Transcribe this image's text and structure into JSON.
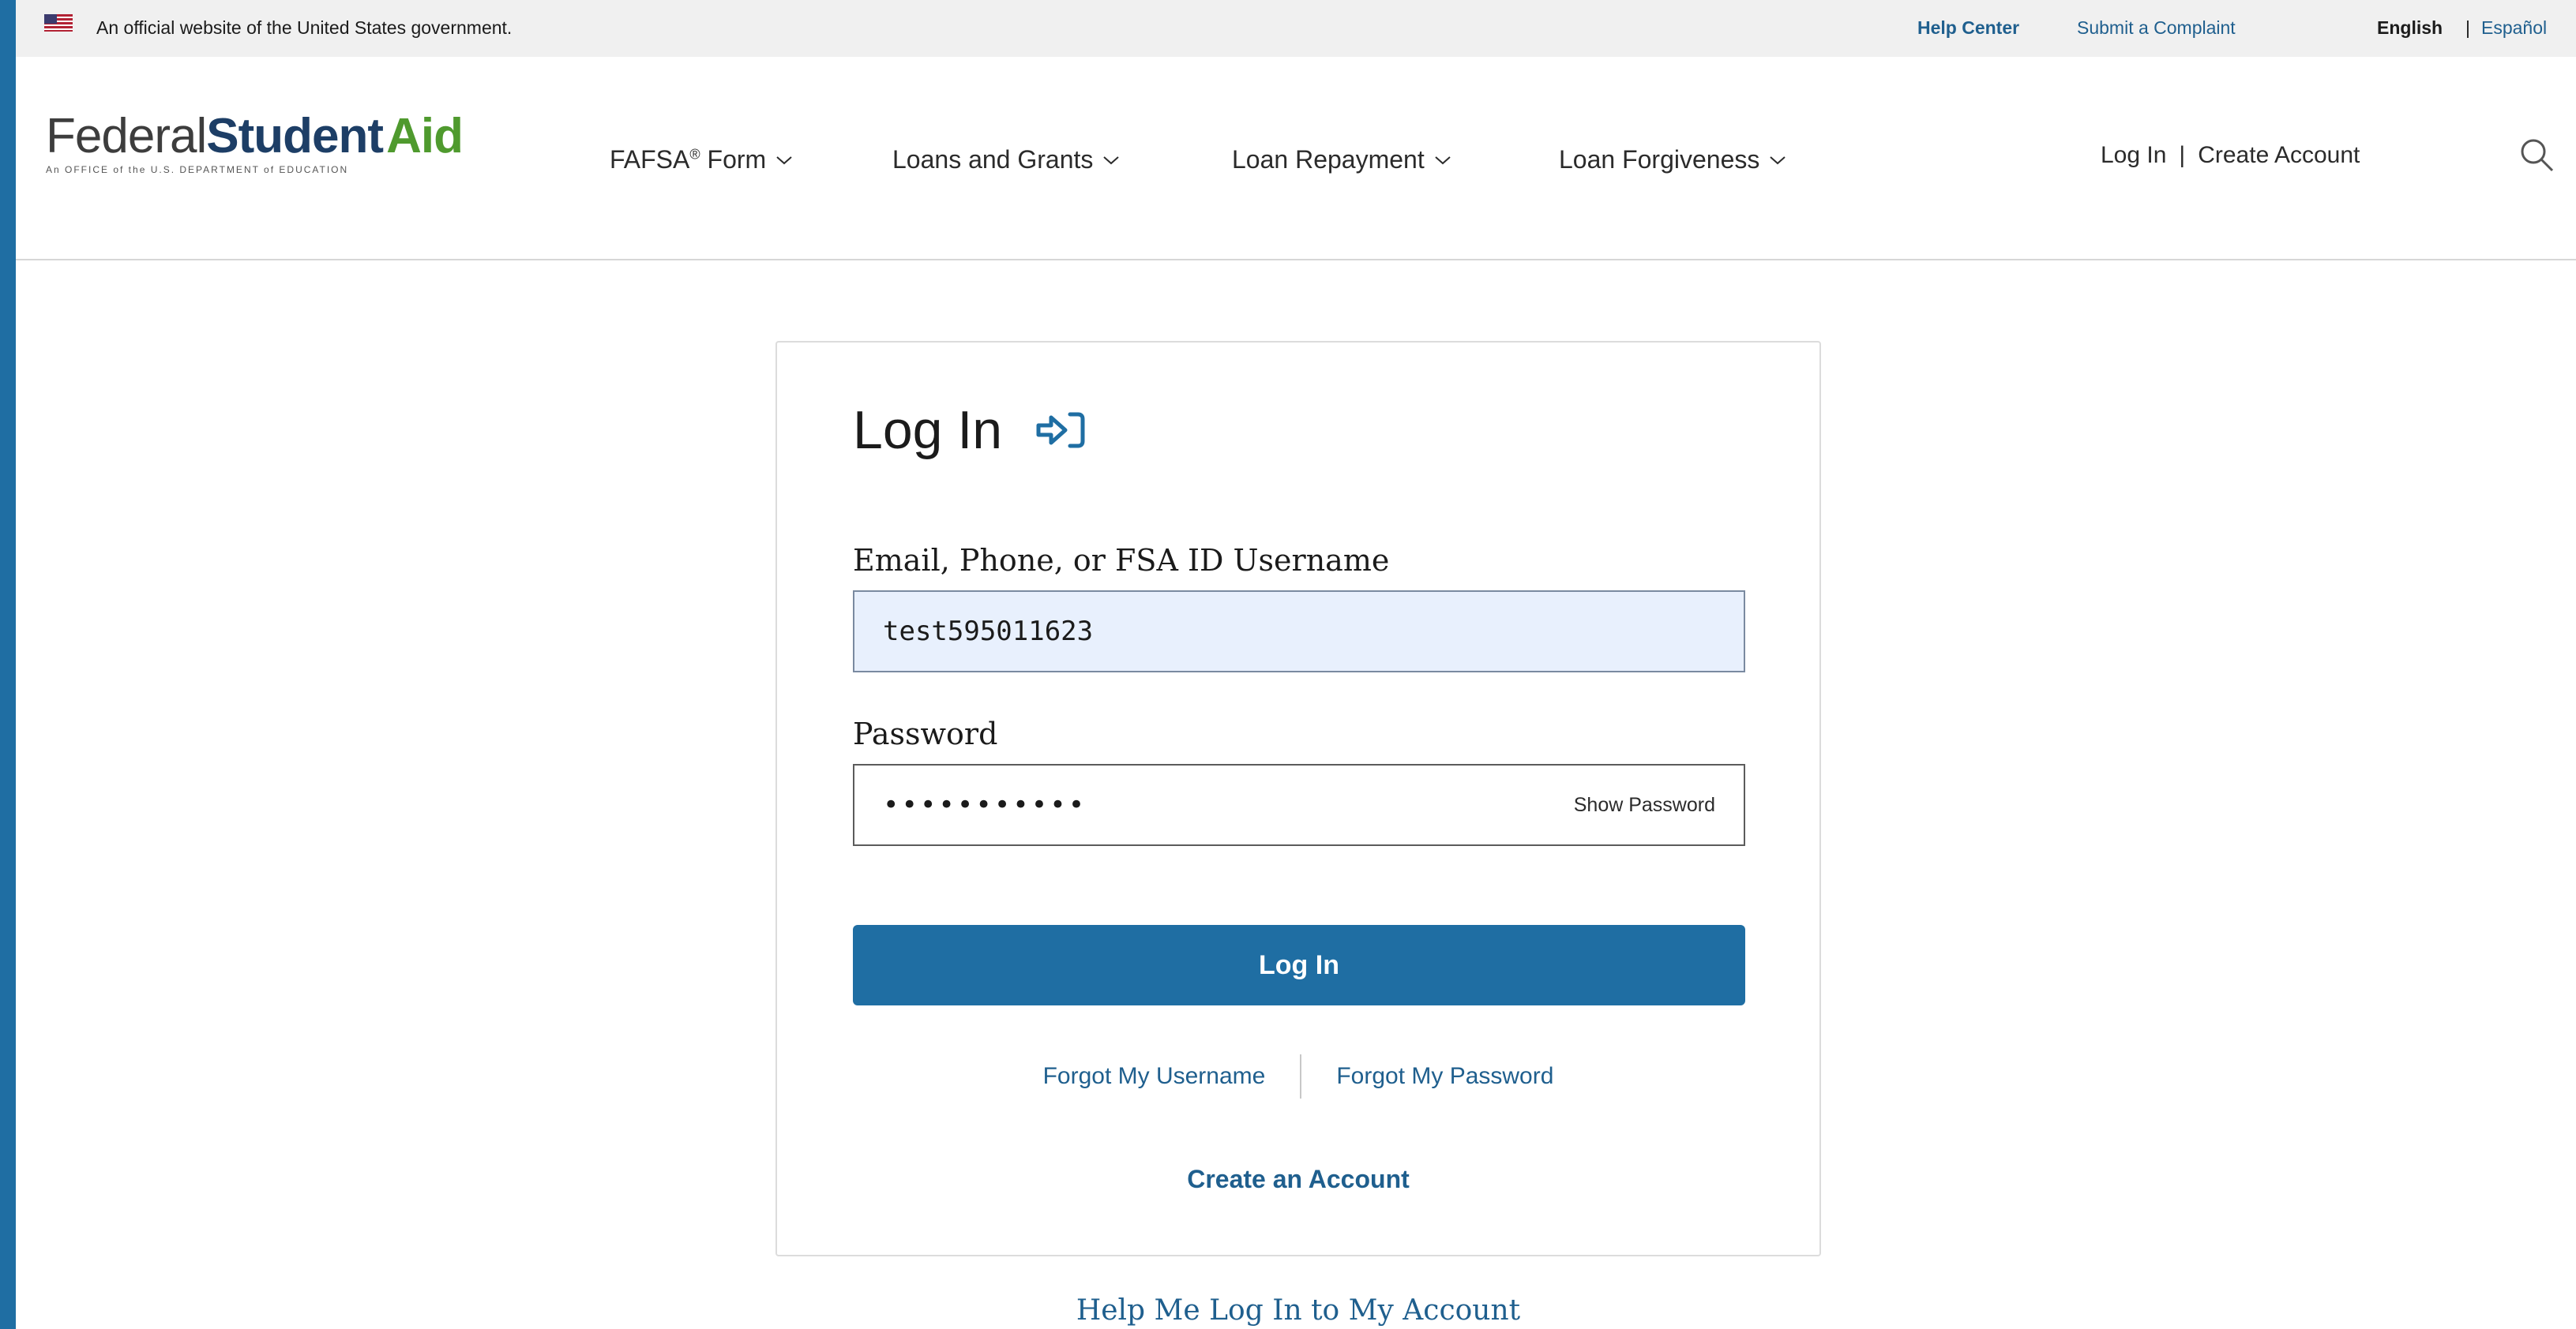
{
  "gov_banner": {
    "text": "An official website of the United States government.",
    "help_center": "Help Center",
    "complaint": "Submit a Complaint",
    "lang_english": "English",
    "lang_separator": "|",
    "lang_spanish": "Español"
  },
  "header": {
    "logo_federal": "Federal",
    "logo_student": "Student",
    "logo_aid": "Aid",
    "logo_subtitle": "An OFFICE of the U.S. DEPARTMENT of EDUCATION",
    "nav": {
      "fafsa": "FAFSA",
      "fafsa_mark": "®",
      "fafsa_suffix": "Form",
      "loans": "Loans and Grants",
      "repayment": "Loan Repayment",
      "forgiveness": "Loan Forgiveness"
    },
    "login_link": "Log In",
    "account_separator": "|",
    "create_account_link": "Create Account"
  },
  "login_card": {
    "title": "Log In",
    "username_label": "Email, Phone, or FSA ID Username",
    "username_value": "test595011623",
    "password_label": "Password",
    "password_masked": "•••••••••••",
    "show_password": "Show Password",
    "submit": "Log In",
    "forgot_username": "Forgot My Username",
    "forgot_password": "Forgot My Password",
    "create_account": "Create an Account"
  },
  "help_link": "Help Me Log In to My Account",
  "colors": {
    "primary": "#1f6ea3",
    "link": "#1f5f8e",
    "logo_green": "#4f9a2e",
    "logo_navy": "#1d3e66",
    "input_fill": "#e8f0fd"
  }
}
